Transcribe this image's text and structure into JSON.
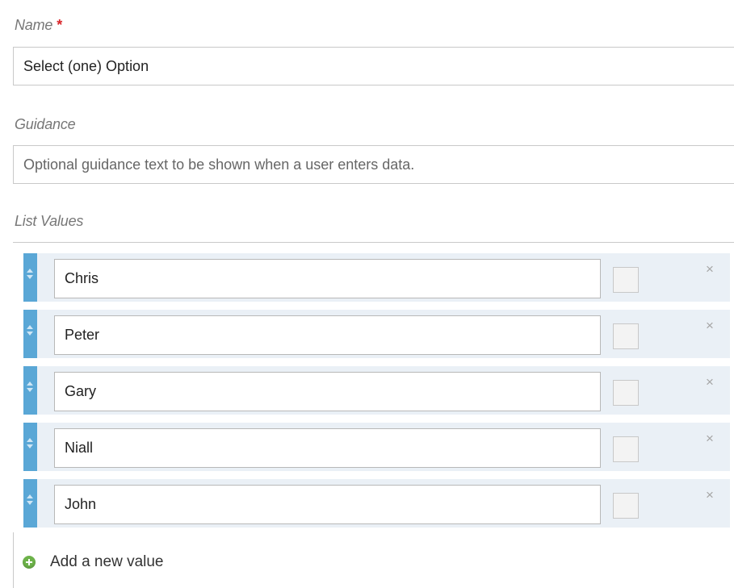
{
  "name_field": {
    "label": "Name",
    "required_marker": "*",
    "value": "Select (one) Option"
  },
  "guidance_field": {
    "label": "Guidance",
    "value": "",
    "placeholder": "Optional guidance text to be shown when a user enters data."
  },
  "list_values": {
    "label": "List Values",
    "items": [
      {
        "value": "Chris",
        "checked": false
      },
      {
        "value": "Peter",
        "checked": false
      },
      {
        "value": "Gary",
        "checked": false
      },
      {
        "value": "Niall",
        "checked": false
      },
      {
        "value": "John",
        "checked": false
      }
    ],
    "remove_glyph": "×",
    "add_label": "Add a new value"
  },
  "colors": {
    "accent": "#5aa7d6",
    "row_background": "#eaf0f6",
    "add_icon": "#6db24a",
    "required": "#d9262a"
  }
}
